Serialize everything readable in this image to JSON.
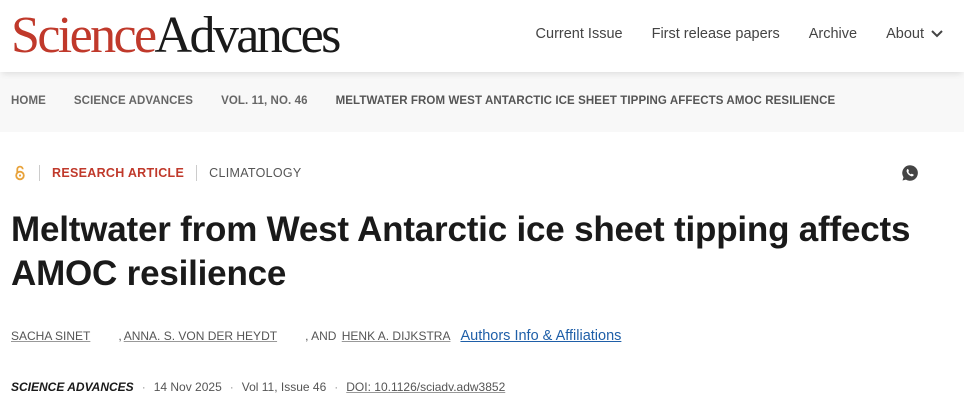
{
  "header": {
    "logo_science": "Science",
    "logo_advances": "Advances",
    "nav": [
      {
        "label": "Current Issue"
      },
      {
        "label": "First release papers"
      },
      {
        "label": "Archive"
      },
      {
        "label": "About"
      }
    ]
  },
  "breadcrumb": [
    "HOME",
    "SCIENCE ADVANCES",
    "VOL. 11, NO. 46",
    "MELTWATER FROM WEST ANTARCTIC ICE SHEET TIPPING AFFECTS AMOC RESILIENCE"
  ],
  "article": {
    "type": "RESEARCH ARTICLE",
    "subject": "CLIMATOLOGY",
    "title": "Meltwater from West Antarctic ice sheet tipping affects AMOC resilience",
    "authors": [
      "SACHA SINET",
      "ANNA. S. VON DER HEYDT",
      "HENK A. DIJKSTRA"
    ],
    "author_sep": ",",
    "author_and": ", AND",
    "affiliations_link": "Authors Info & Affiliations",
    "journal": "SCIENCE ADVANCES",
    "date": "14 Nov 2025",
    "volume_issue": "Vol 11, Issue 46",
    "doi": "DOI: 10.1126/sciadv.adw3852"
  },
  "colors": {
    "brand_red": "#c0392b",
    "link_blue": "#1f5fa8",
    "open_access_orange": "#e8a23a"
  },
  "icons": [
    "open-access-icon",
    "chevron-down-icon",
    "whatsapp-share-icon"
  ]
}
